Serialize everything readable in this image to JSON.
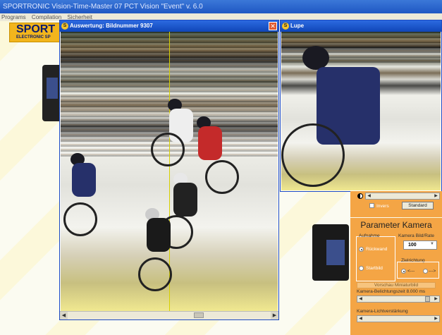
{
  "app": {
    "title": "SPORTRONIC Vision-Time-Master 07 PCT Vision \"Event\"  v. 6.0",
    "menu": [
      "Programs",
      "Compilation",
      "Sicherheit"
    ]
  },
  "logo": {
    "brand": "SPORT",
    "sub": "ELECTRONIC SP"
  },
  "auswertung_window": {
    "title": "Auswertung:  Bildnummer 9307",
    "close_label": "✕"
  },
  "lupe_window": {
    "title": "Lupe"
  },
  "display_panel": {
    "invers_label": "Invers",
    "standard_button": "Standard"
  },
  "parameter_panel": {
    "title": "Parameter Kamera",
    "aufnahme_label": "Aufnahme",
    "option_rueckwand": "Rückwand",
    "option_startbild": "Startbild",
    "bildrate_label": "Kamera Bild/Rate",
    "bildrate_value": "100",
    "zielrichtung_label": "Zielrichtung",
    "dir_left": "<---",
    "dir_right": "--->",
    "vorschau_label": "Vorschau Miniaturbild",
    "belichtung_label": "Kamera-Belichtungszeit 8.000 ms",
    "licht_label": "Kamera-Lichtverstärkung"
  },
  "colors": {
    "title_bar": "#1f57c3",
    "panel_orange": "#f4a545",
    "close_red": "#e05a30"
  }
}
